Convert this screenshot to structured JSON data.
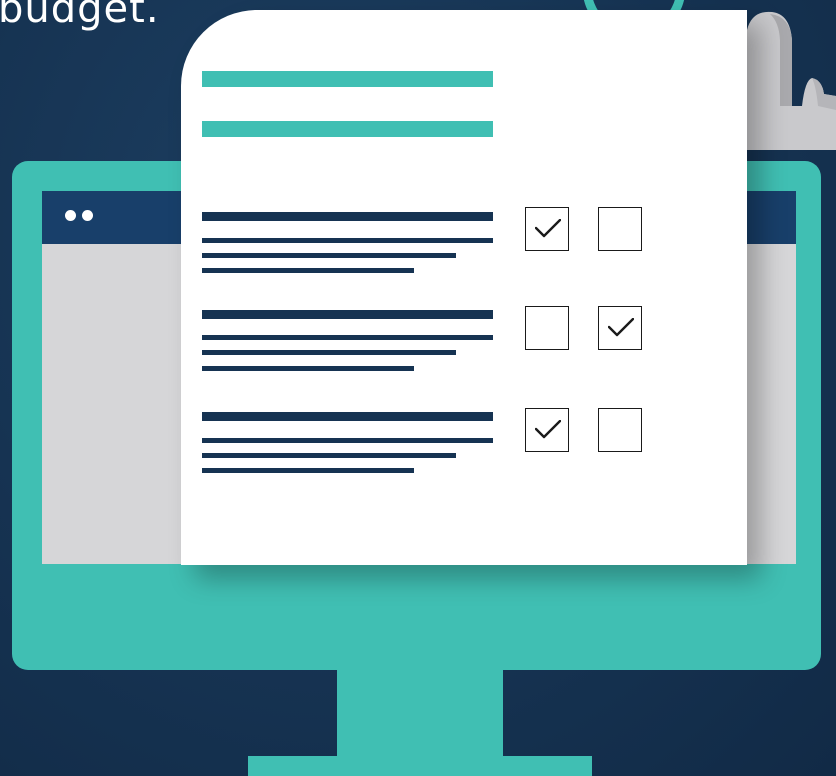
{
  "headline": {
    "text": "budget."
  },
  "colors": {
    "background": "#163352",
    "accent_teal": "#40bfb3",
    "window_bar": "#183f6a",
    "window_body": "#d6d6d8",
    "document": "#ffffff",
    "text_lines": "#163352"
  },
  "icons": {
    "magnifier": "magnifier-icon",
    "checkmark": "checkmark-icon"
  },
  "checklist": [
    {
      "left_checked": true,
      "right_checked": false
    },
    {
      "left_checked": false,
      "right_checked": true
    },
    {
      "left_checked": true,
      "right_checked": false
    }
  ]
}
